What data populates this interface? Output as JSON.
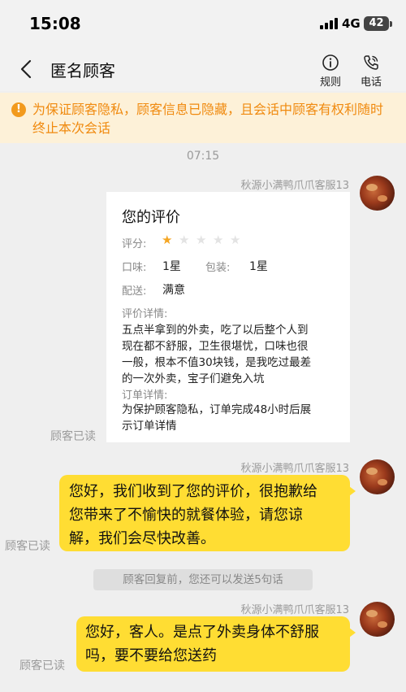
{
  "status_bar": {
    "time": "15:08",
    "network": "4G",
    "battery": "42"
  },
  "nav": {
    "title": "匿名顾客",
    "rules_label": "规则",
    "phone_label": "电话"
  },
  "notice": {
    "text": "为保证顾客隐私，顾客信息已隐藏，且会话中顾客有权利随时终止本次会话"
  },
  "chat": {
    "timestamp": "07:15",
    "messages": [
      {
        "sender": "秋源小满鸭爪爪客服13",
        "read_status": "顾客已读",
        "card": {
          "title": "您的评价",
          "rating_label": "评分:",
          "rating_value": 1,
          "rating_max": 5,
          "taste_label": "口味:",
          "taste_value": "1星",
          "package_label": "包装:",
          "package_value": "1星",
          "delivery_label": "配送:",
          "delivery_value": "满意",
          "detail_label": "评价详情:",
          "detail_lines": [
            "五点半拿到的外卖，吃了以后整个人到",
            "现在都不舒服，卫生很堪忧，口味也很",
            "一般，根本不值30块钱，是我吃过最差",
            "的一次外卖，宝子们避免入坑"
          ],
          "order_label": "订单详情:",
          "order_lines": [
            "为保护顾客隐私，订单完成48小时后展",
            "示订单详情"
          ]
        }
      },
      {
        "sender": "秋源小满鸭爪爪客服13",
        "read_status": "顾客已读",
        "lines": [
          "您好，我们收到了您的评价，很抱歉给",
          "您带来了不愉快的就餐体验，请您谅",
          "解，我们会尽快改善。"
        ]
      },
      {
        "system_tip": "顾客回复前，您还可以发送5句话"
      },
      {
        "sender": "秋源小满鸭爪爪客服13",
        "read_status": "顾客已读",
        "lines": [
          "您好，客人。是点了外卖身体不舒服",
          "吗，要不要给您送药"
        ]
      }
    ]
  },
  "colors": {
    "notice_bg": "#fdf1d8",
    "notice_text": "#f08a0f",
    "bubble": "#ffdd33",
    "star_filled": "#f5a623",
    "star_empty": "#e3e3e3"
  },
  "icons": [
    "back-icon",
    "info-icon",
    "phone-icon",
    "warning-icon",
    "star-icon",
    "avatar"
  ]
}
